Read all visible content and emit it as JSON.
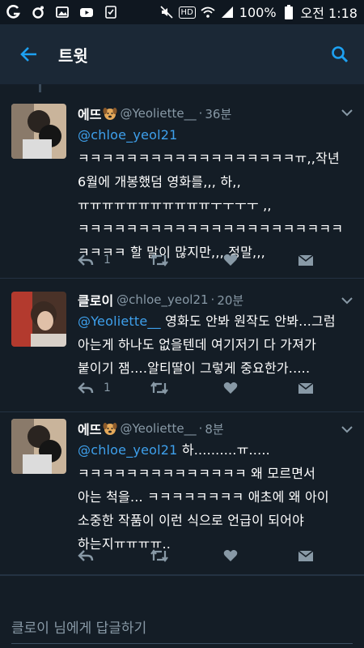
{
  "status_bar": {
    "battery_percent": "100%",
    "clock": "오전 1:18",
    "hd_label": "HD",
    "icons": [
      "g-icon",
      "circle-app-icon",
      "gallery-icon",
      "youtube-icon",
      "checklist-icon",
      "mute-icon",
      "wifi-icon",
      "signal-icon",
      "battery-icon"
    ]
  },
  "app_bar": {
    "title": "트윗",
    "back_icon": "arrow-left-icon",
    "search_icon": "search-icon"
  },
  "tweets": [
    {
      "name": "에뜨",
      "emoji": "dog-face-emoji",
      "handle": "@Yeoliette__",
      "time": "36분",
      "mention": "@chloe_yeol21",
      "lines": [
        "ㅋㅋㅋㅋㅋㅋㅋㅋㅋㅋㅋㅋㅋㅋㅋㅋㅋㅋㅠ,,작년",
        "6월에 개봉했덤 영화를,,, 하,,",
        "ㅠㅠㅠㅠㅠㅠㅠㅠㅠㅠㅠㅜㅜㅜㅜ ,,",
        "ㅋㅋㅋㅋㅋㅋㅋㅋㅋㅋㅋㅋㅋㅋㅋㅋㅋㅋㅋㅋㅋㅋ",
        "ㅋㅋㅋㅋ 할 말이 많지만,,, 정말,,,"
      ],
      "reply_count": "1"
    },
    {
      "name": "클로이",
      "handle": "@chloe_yeol21",
      "time": "20분",
      "mention": "@Yeoliette__",
      "first_line_rest": " 영화도 안봐 원작도 안봐...그럼",
      "lines": [
        "아는게 하나도 없을텐데 여기저기 다 가져가",
        "붙이기 잼....알티딸이 그렇게 중요한가....."
      ],
      "reply_count": "1"
    },
    {
      "name": "에뜨",
      "emoji": "dog-face-emoji",
      "handle": "@Yeoliette__",
      "time": "8분",
      "mention": "@chloe_yeol21",
      "first_line_rest": " 하..........ㅠ.....",
      "lines": [
        "ㅋㅋㅋㅋㅋㅋㅋㅋㅋㅋㅋㅋㅋㅋ 왜 모르면서",
        "아는 척을... ㅋㅋㅋㅋㅋㅋㅋㅋ 애초에 왜 아이",
        "소중한 작품이 이런 식으로 언급이 되어야",
        "하는지ㅠㅠㅠㅠ.."
      ],
      "reply_count": ""
    }
  ],
  "compose": {
    "placeholder": "클로이 님에게 답글하기"
  },
  "colors": {
    "background": "#141d26",
    "app_bar": "#1b2836",
    "accent": "#1da1f2",
    "mention": "#3ea0ec",
    "muted": "#8899a6"
  }
}
